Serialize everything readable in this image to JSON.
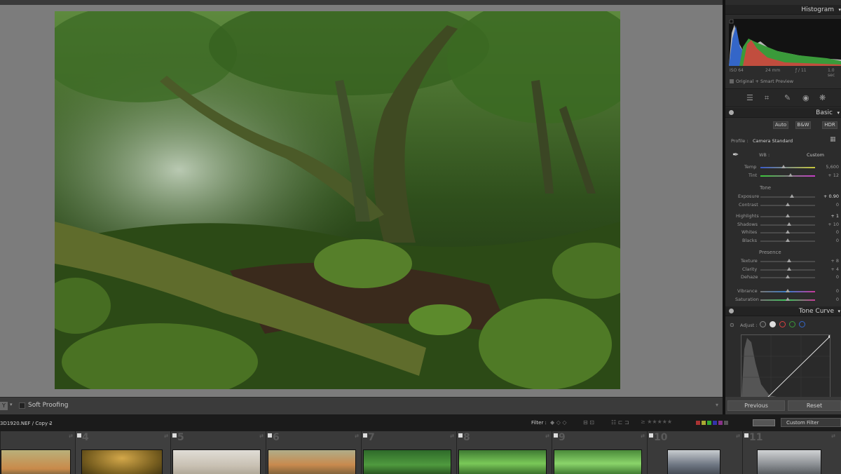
{
  "panel": {
    "histogram_title": "Histogram",
    "exif": {
      "iso": "ISO 64",
      "focal": "24 mm",
      "aperture": "ƒ / 11",
      "shutter": "1.0 sec"
    },
    "preview_label": "Original + Smart Preview",
    "basic_title": "Basic",
    "treatment_buttons": [
      "Auto",
      "B&W",
      "HDR"
    ],
    "profile_label": "Profile :",
    "profile_value": "Camera Standard",
    "wb_label": "WB :",
    "wb_value": "Custom",
    "temp": {
      "label": "Temp",
      "value": "5,600",
      "level": 0.42
    },
    "tint": {
      "label": "Tint",
      "value": "+ 12",
      "level": 0.55
    },
    "tone_label": "Tone",
    "exposure": {
      "label": "Exposure",
      "value": "+ 0.90",
      "level": 0.58
    },
    "contrast": {
      "label": "Contrast",
      "value": "0",
      "level": 0.5
    },
    "highlights": {
      "label": "Highlights",
      "value": "+ 1",
      "level": 0.5
    },
    "shadows": {
      "label": "Shadows",
      "value": "+ 10",
      "level": 0.52
    },
    "whites": {
      "label": "Whites",
      "value": "0",
      "level": 0.5
    },
    "blacks": {
      "label": "Blacks",
      "value": "0",
      "level": 0.5
    },
    "presence_label": "Presence",
    "texture": {
      "label": "Texture",
      "value": "+ 8",
      "level": 0.53
    },
    "clarity": {
      "label": "Clarity",
      "value": "+ 4",
      "level": 0.52
    },
    "dehaze": {
      "label": "Dehaze",
      "value": "0",
      "level": 0.5
    },
    "vibrance": {
      "label": "Vibrance",
      "value": "0",
      "level": 0.5
    },
    "saturation": {
      "label": "Saturation",
      "value": "0",
      "level": 0.5
    },
    "tone_curve_title": "Tone Curve",
    "adjust_label": "Adjust :",
    "previous_label": "Previous",
    "reset_label": "Reset"
  },
  "toolbar": {
    "view_mode": "Y",
    "soft_proofing_label": "Soft Proofing"
  },
  "filmbar": {
    "path": "3D1920.NEF / Copy 2",
    "filter_label": "Filter :",
    "custom_filter": "Custom Filter"
  },
  "filmstrip": [
    {
      "num": ""
    },
    {
      "num": "4"
    },
    {
      "num": "5"
    },
    {
      "num": "6"
    },
    {
      "num": "7"
    },
    {
      "num": "8"
    },
    {
      "num": "9"
    },
    {
      "num": "10"
    },
    {
      "num": "11"
    }
  ],
  "colors": {
    "channel_red": "#d94040",
    "channel_green": "#3a9a3a",
    "channel_blue": "#3466c8"
  }
}
